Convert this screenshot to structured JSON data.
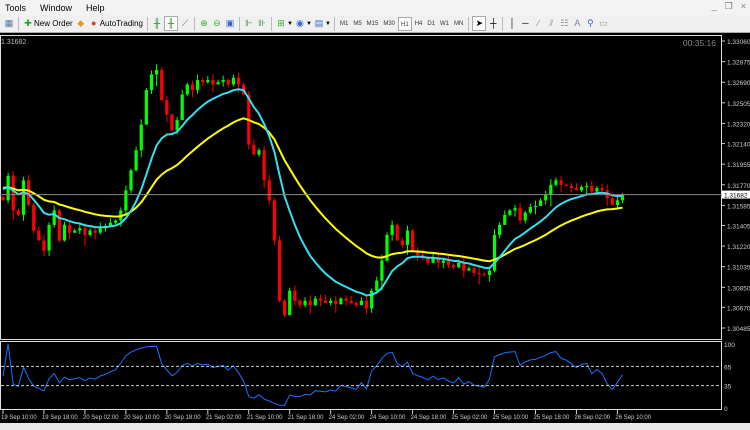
{
  "menu": {
    "items": [
      "Tools",
      "Window",
      "Help"
    ]
  },
  "window_controls": [
    "_",
    "❐",
    "×"
  ],
  "toolbar": {
    "new_order": "New Order",
    "autotrading": "AutoTrading",
    "timeframes": [
      "M1",
      "M5",
      "M15",
      "M30",
      "H1",
      "H4",
      "D1",
      "W1",
      "MN"
    ],
    "active_timeframe": "H1"
  },
  "chart": {
    "symbol_price_label": "1.31682",
    "current_price": 1.31682,
    "timer": "00:35:16",
    "colors": {
      "bull": "#00ff00",
      "bear": "#ff0000",
      "ema_fast": "#33e0f0",
      "ema_slow": "#ffff00",
      "osc": "#1e6fff"
    },
    "price_axis": [
      "1.33060",
      "1.32875",
      "1.32690",
      "1.32505",
      "1.32320",
      "1.32140",
      "1.31955",
      "1.31770",
      "1.31585",
      "1.31405",
      "1.31220",
      "1.31035",
      "1.30850",
      "1.30670",
      "1.30485"
    ],
    "osc_axis": [
      "100",
      "65",
      "35",
      "0"
    ],
    "time_axis": [
      "19 Sep 10:00",
      "19 Sep 18:00",
      "20 Sep 02:00",
      "20 Sep 10:00",
      "20 Sep 18:00",
      "21 Sep 02:00",
      "21 Sep 10:00",
      "21 Sep 18:00",
      "24 Sep 02:00",
      "24 Sep 10:00",
      "24 Sep 18:00",
      "25 Sep 02:00",
      "25 Sep 10:00",
      "25 Sep 18:00",
      "26 Sep 02:00",
      "26 Sep 10:00"
    ],
    "closes": [
      1.3163,
      1.3185,
      1.3154,
      1.315,
      1.3181,
      1.3159,
      1.3136,
      1.3127,
      1.3118,
      1.3141,
      1.3154,
      1.3127,
      1.3141,
      1.3134,
      1.3136,
      1.3138,
      1.3132,
      1.3136,
      1.3134,
      1.3138,
      1.314,
      1.3143,
      1.3145,
      1.3154,
      1.3172,
      1.319,
      1.3208,
      1.3231,
      1.3262,
      1.3276,
      1.328,
      1.3253,
      1.324,
      1.3226,
      1.3235,
      1.3258,
      1.3267,
      1.3262,
      1.3271,
      1.3269,
      1.3271,
      1.3267,
      1.3269,
      1.3271,
      1.3267,
      1.3273,
      1.3267,
      1.3258,
      1.3213,
      1.3204,
      1.3208,
      1.3181,
      1.3163,
      1.3127,
      1.3073,
      1.306,
      1.3082,
      1.3073,
      1.3069,
      1.3073,
      1.3069,
      1.3075,
      1.3073,
      1.3071,
      1.3073,
      1.307,
      1.3075,
      1.3073,
      1.3071,
      1.3069,
      1.3073,
      1.3066,
      1.3082,
      1.3091,
      1.3109,
      1.3132,
      1.3141,
      1.3127,
      1.3123,
      1.3136,
      1.3118,
      1.3114,
      1.3111,
      1.3107,
      1.3112,
      1.3107,
      1.3109,
      1.3105,
      1.3103,
      1.3107,
      1.31,
      1.3102,
      1.3098,
      1.3097,
      1.3096,
      1.31,
      1.3132,
      1.3141,
      1.315,
      1.3154,
      1.3156,
      1.3145,
      1.3152,
      1.3157,
      1.3158,
      1.3163,
      1.3168,
      1.3177,
      1.3181,
      1.3177,
      1.3176,
      1.3174,
      1.3172,
      1.3175,
      1.3176,
      1.3171,
      1.3174,
      1.3172,
      1.3165,
      1.3159,
      1.3163,
      1.31682
    ]
  }
}
